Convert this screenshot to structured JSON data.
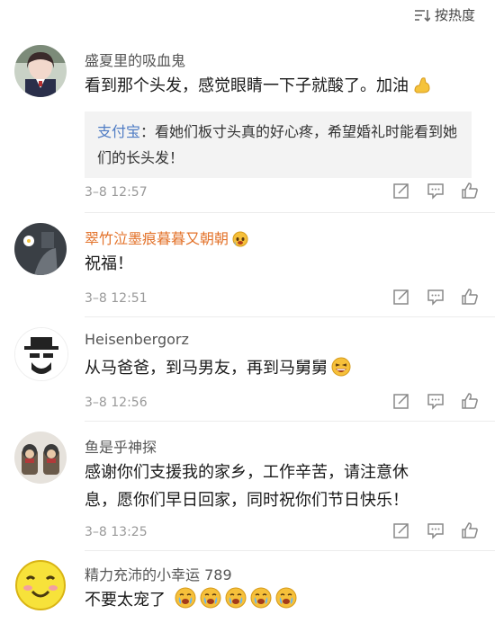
{
  "sort": {
    "label": "按热度",
    "icon": "sort-icon"
  },
  "comments": [
    {
      "username": "盛夏里的吸血鬼",
      "text": "看到那个头发，感觉眼睛一下子就酸了。加油",
      "emoji": "flexed-biceps-emoji",
      "reply": {
        "username": "支付宝",
        "text": "看她们板寸头真的好心疼，希望婚礼时能看到她们的长头发！"
      },
      "time": "3–8 12:57"
    },
    {
      "username": "翠竹泣墨痕暮暮又朝朝",
      "username_color": "#e3732b",
      "text": "祝福！",
      "time": "3–8 12:51"
    },
    {
      "username": "Heisenbergorz",
      "text": "从马爸爸，到马男友，再到马舅舅",
      "emoji": "laughing-emoji",
      "time": "3–8 12:56"
    },
    {
      "username": "鱼是乎神探",
      "text_lines": [
        "感谢你们支援我的家乡，工作辛苦，请注意休",
        "息，愿你们早日回家，同时祝你们节日快乐！"
      ],
      "time": "3–8 13:25"
    },
    {
      "username": "精力充沛的小幸运 789",
      "text": "不要太宠了",
      "emoji": "crying-face-emoji"
    }
  ],
  "actions": [
    "share-icon",
    "comment-icon",
    "like-icon"
  ],
  "colors": {
    "reply_name": "#4f7cc4",
    "time": "#999999",
    "username": "#555555"
  }
}
